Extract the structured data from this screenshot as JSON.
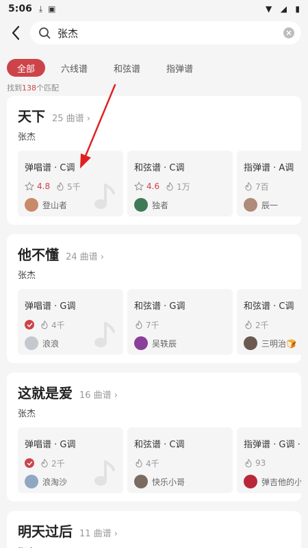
{
  "status": {
    "time": "5:06"
  },
  "search": {
    "query": "张杰"
  },
  "filters": [
    {
      "label": "全部",
      "active": true
    },
    {
      "label": "六线谱",
      "active": false
    },
    {
      "label": "和弦谱",
      "active": false
    },
    {
      "label": "指弹谱",
      "active": false
    }
  ],
  "match": {
    "prefix": "找到",
    "count": "138",
    "suffix": "个匹配"
  },
  "songs": [
    {
      "title": "天下",
      "count": "25 曲谱",
      "artist": "张杰",
      "tabs": [
        {
          "type": "弹唱谱 · C调",
          "star": true,
          "rating": "4.8",
          "heat": "5千",
          "author": "登山者",
          "avatar": "#c98a6a",
          "note": true
        },
        {
          "type": "和弦谱 · C调",
          "star": true,
          "rating": "4.6",
          "heat": "1万",
          "author": "独者",
          "avatar": "#3f7a56"
        },
        {
          "type": "指弹谱 · A调",
          "heat": "7百",
          "author": "辰一",
          "avatar": "#b08a7a"
        }
      ]
    },
    {
      "title": "他不懂",
      "count": "24 曲谱",
      "artist": "张杰",
      "tabs": [
        {
          "type": "弹唱谱 · G调",
          "badge": true,
          "heat": "4千",
          "author": "浪浪",
          "avatar": "#c5c8cf",
          "note": true
        },
        {
          "type": "和弦谱 · G调",
          "heat": "7千",
          "author": "吴轶辰",
          "avatar": "#8a3f9a"
        },
        {
          "type": "和弦谱 · C调",
          "heat": "2千",
          "author": "三明治🍞",
          "avatar": "#6a5a50"
        }
      ]
    },
    {
      "title": "这就是爱",
      "count": "16 曲谱",
      "artist": "张杰",
      "tabs": [
        {
          "type": "弹唱谱 · G调",
          "badge": true,
          "heat": "2千",
          "author": "浪淘沙",
          "avatar": "#8fa7c2",
          "note": true
        },
        {
          "type": "和弦谱 · C调",
          "heat": "4千",
          "author": "快乐小哥",
          "avatar": "#7a6a60"
        },
        {
          "type": "指弹谱 · G调 · 简",
          "heat": "93",
          "author": "弹吉他的小",
          "avatar": "#b8283a"
        }
      ]
    },
    {
      "title": "明天过后",
      "count": "11 曲谱",
      "artist": "张杰",
      "tabs": []
    }
  ]
}
